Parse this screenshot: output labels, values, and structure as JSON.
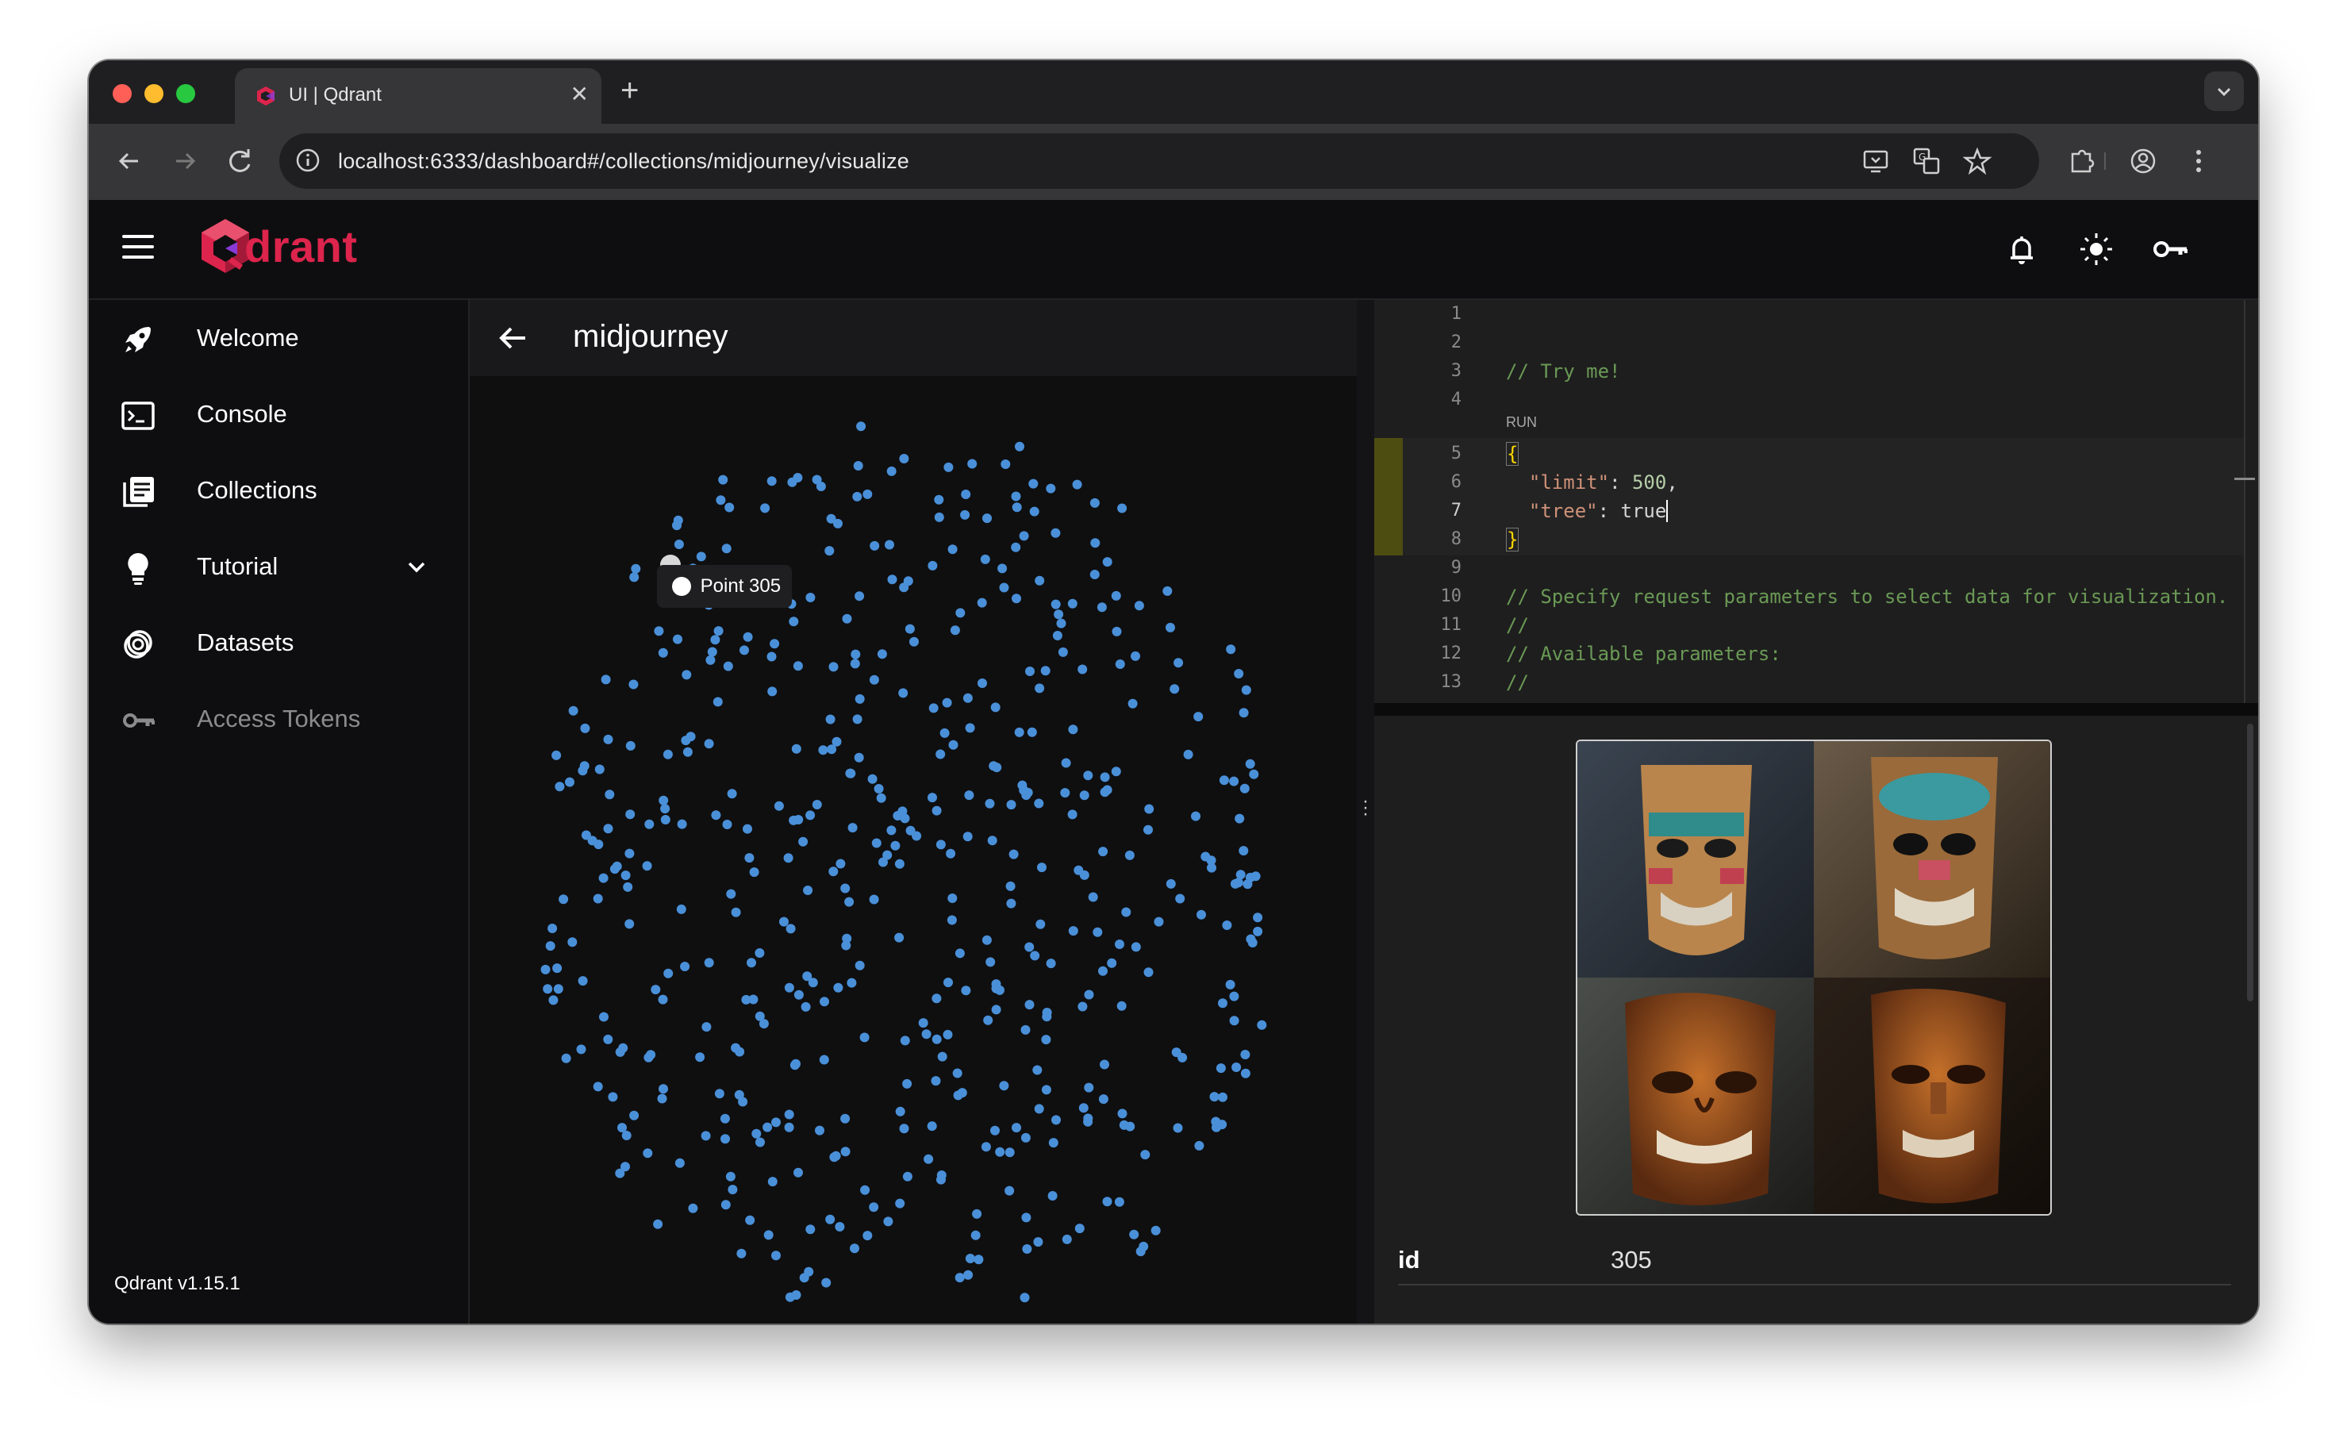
{
  "browser": {
    "tab_title": "UI | Qdrant",
    "new_tab": "+",
    "url": "localhost:6333/dashboard#/collections/midjourney/visualize"
  },
  "app": {
    "logo_text": "drant",
    "brand_color": "#dc244c"
  },
  "sidebar": {
    "items": [
      {
        "label": "Welcome",
        "icon": "rocket-icon"
      },
      {
        "label": "Console",
        "icon": "terminal-icon"
      },
      {
        "label": "Collections",
        "icon": "collections-icon"
      },
      {
        "label": "Tutorial",
        "icon": "lightbulb-icon"
      },
      {
        "label": "Datasets",
        "icon": "datasets-icon"
      },
      {
        "label": "Access Tokens",
        "icon": "key-icon"
      }
    ],
    "version": "Qdrant v1.15.1"
  },
  "main": {
    "collection_name": "midjourney",
    "tooltip": "Point 305",
    "point_color": "#4a90d9"
  },
  "editor": {
    "run_label": "RUN",
    "line_numbers": [
      "1",
      "2",
      "3",
      "4",
      "5",
      "6",
      "7",
      "8",
      "9",
      "10",
      "11",
      "12",
      "13"
    ],
    "comment_try": "// Try me!",
    "open_brace": "{",
    "limit_key": "\"limit\"",
    "limit_val": "500",
    "tree_key": "\"tree\"",
    "tree_val": "true",
    "close_brace": "}",
    "comment_specify": "// Specify request parameters to select data for visualization.",
    "comment_blank": "//",
    "comment_available": "// Available parameters:",
    "comment_blank2": "//"
  },
  "details": {
    "id_key": "id",
    "id_value": "305"
  }
}
